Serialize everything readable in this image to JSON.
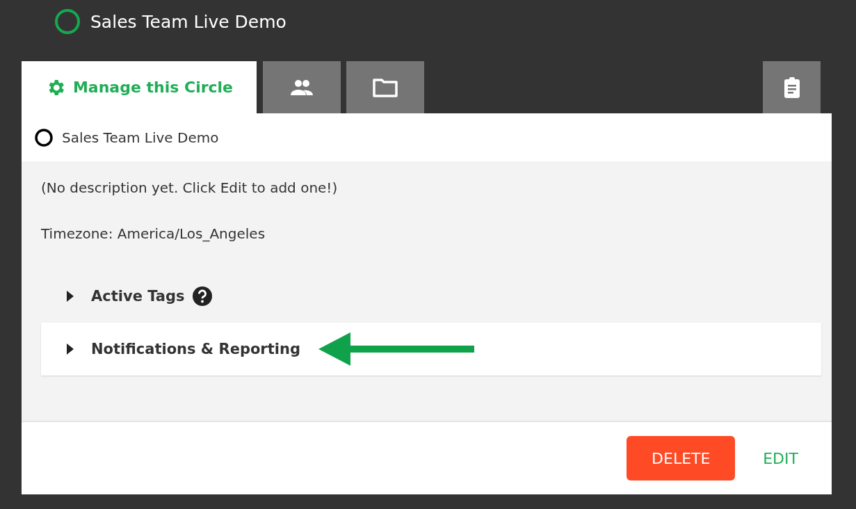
{
  "header": {
    "title": "Sales Team Live Demo"
  },
  "tabs": [
    {
      "kind": "label",
      "label": "Manage this Circle",
      "selected": true
    },
    {
      "kind": "icon",
      "selected": false
    },
    {
      "kind": "icon",
      "selected": false
    },
    {
      "kind": "icon",
      "selected": false
    }
  ],
  "circle": {
    "name": "Sales Team Live Demo",
    "description": "(No description yet. Click Edit to add one!)",
    "timezone": "Timezone: America/Los_Angeles"
  },
  "sections": [
    {
      "label": "Active Tags",
      "help": true,
      "expanded": false,
      "selected": false
    },
    {
      "label": "Notifications & Reporting",
      "help": false,
      "expanded": false,
      "selected": true
    }
  ],
  "buttons": [
    {
      "kind": "danger",
      "label": "DELETE"
    },
    {
      "kind": "link",
      "label": "EDIT"
    }
  ]
}
